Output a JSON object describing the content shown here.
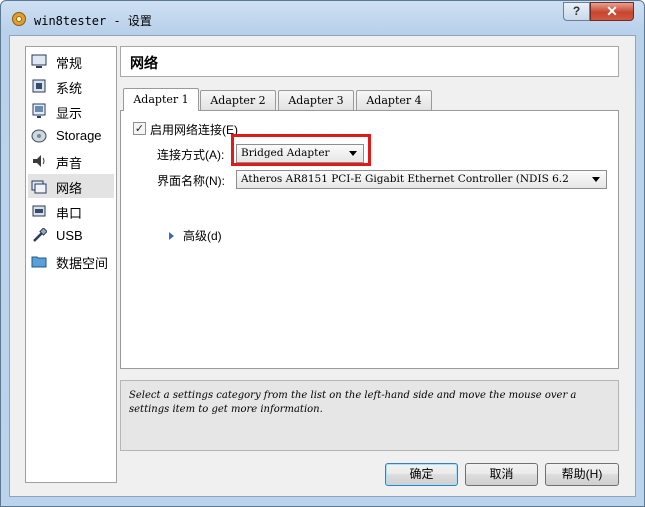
{
  "window": {
    "title": "win8tester - 设置",
    "help_button": "?",
    "close_button": "✕"
  },
  "sidebar": {
    "items": [
      {
        "label": "常规",
        "icon": "monitor-icon"
      },
      {
        "label": "系统",
        "icon": "chip-icon"
      },
      {
        "label": "显示",
        "icon": "display-icon"
      },
      {
        "label": "Storage",
        "icon": "disk-icon"
      },
      {
        "label": "声音",
        "icon": "speaker-icon"
      },
      {
        "label": "网络",
        "icon": "network-icon"
      },
      {
        "label": "串口",
        "icon": "serial-port-icon"
      },
      {
        "label": "USB",
        "icon": "usb-icon"
      },
      {
        "label": "数据空间",
        "icon": "folder-icon"
      }
    ],
    "selected": "网络"
  },
  "header": {
    "title": "网络"
  },
  "tabs": [
    {
      "label": "Adapter 1",
      "active": true
    },
    {
      "label": "Adapter 2",
      "active": false
    },
    {
      "label": "Adapter 3",
      "active": false
    },
    {
      "label": "Adapter 4",
      "active": false
    }
  ],
  "adapter": {
    "enable_label": "启用网络连接(E)",
    "enable_checked": true,
    "attached_label": "连接方式(A):",
    "attached_value": "Bridged Adapter",
    "name_label": "界面名称(N):",
    "name_value": "Atheros AR8151 PCI-E Gigabit Ethernet Controller (NDIS 6.2",
    "advanced_label": "高级(d)"
  },
  "info": {
    "text": "Select a settings category from the list on the left-hand side and move the mouse over a settings item to get more information."
  },
  "buttons": {
    "ok": "确定",
    "cancel": "取消",
    "help": "帮助(H)"
  },
  "colors": {
    "highlight": "#e01a1a",
    "titlebar": "#b9d1ea",
    "close": "#c7452e"
  }
}
